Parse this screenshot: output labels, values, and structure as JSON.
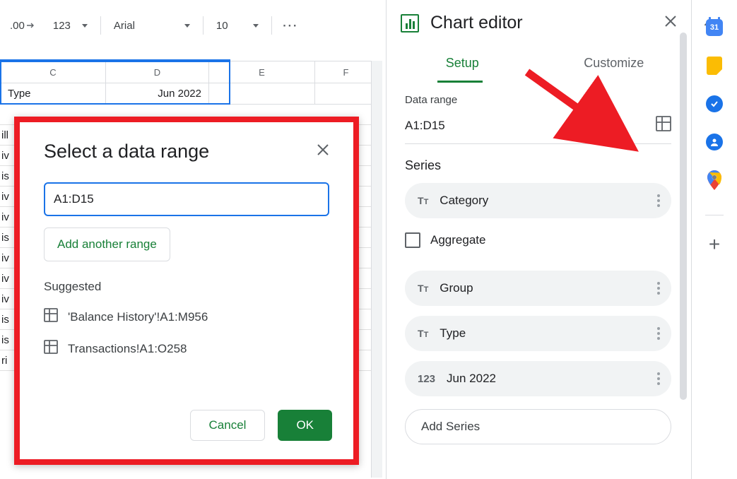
{
  "toolbar": {
    "decimal": ".00",
    "format": "123",
    "font": "Arial",
    "fontsize": "10"
  },
  "sheet": {
    "cols": {
      "c": "C",
      "d": "D",
      "e": "E",
      "f": "F"
    },
    "hdr_c": "Type",
    "hdr_d": "Jun 2022",
    "rows_left": [
      "",
      "ill",
      "iv",
      "is",
      "iv",
      "iv",
      "is",
      "iv",
      "iv",
      "iv",
      "is",
      "is",
      "ri"
    ]
  },
  "dialog": {
    "title": "Select a data range",
    "value": "A1:D15",
    "add_range": "Add another range",
    "suggested": "Suggested",
    "suggestions": [
      "'Balance History'!A1:M956",
      "Transactions!A1:O258"
    ],
    "cancel": "Cancel",
    "ok": "OK"
  },
  "editor": {
    "title": "Chart editor",
    "tab_setup": "Setup",
    "tab_customize": "Customize",
    "data_range_lbl": "Data range",
    "data_range_val": "A1:D15",
    "series_lbl": "Series",
    "series_category": "Category",
    "aggregate": "Aggregate",
    "group": "Group",
    "type": "Type",
    "jun2022": "Jun 2022",
    "add_series": "Add Series"
  },
  "rail": {
    "cal": "31"
  }
}
